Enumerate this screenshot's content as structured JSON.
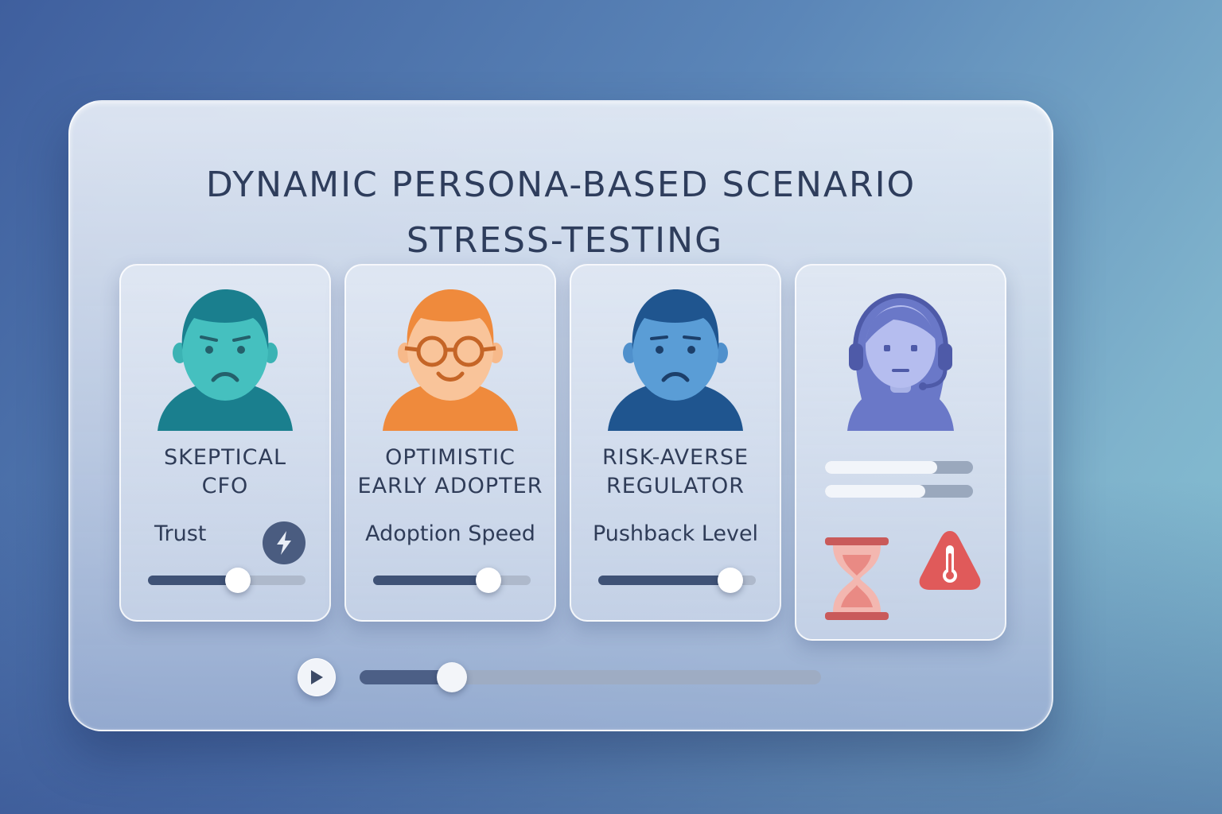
{
  "title": {
    "line1": "DYNAMIC PERSONA-BASED SCENARIO",
    "line2": "STRESS-TESTING"
  },
  "personas": [
    {
      "name_line1": "SKEPTICAL",
      "name_line2": "CFO",
      "metric_label": "Trust",
      "slider_value": 0.57,
      "color": "#1f8a9a",
      "icon": "skeptical-face-icon",
      "badge_icon": "lightning-icon"
    },
    {
      "name_line1": "OPTIMISTIC",
      "name_line2": "EARLY ADOPTER",
      "metric_label": "Adoption Speed",
      "slider_value": 0.73,
      "color": "#f28a3e",
      "icon": "glasses-smiling-face-icon"
    },
    {
      "name_line1": "RISK-AVERSE",
      "name_line2": "REGULATOR",
      "metric_label": "Pushback Level",
      "slider_value": 0.84,
      "color": "#2f66a8",
      "icon": "worried-face-icon"
    }
  ],
  "agent_card": {
    "icon": "headset-agent-icon",
    "color": "#6a78c8",
    "bars": [
      0.76,
      0.68
    ],
    "status_icons": [
      "hourglass-icon",
      "thermometer-warning-icon"
    ],
    "warning_color": "#e05a5a"
  },
  "playback": {
    "icon": "play-icon",
    "progress": 0.2
  }
}
